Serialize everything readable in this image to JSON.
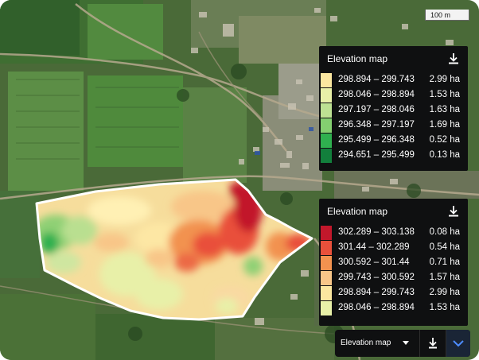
{
  "scale_label": "100 m",
  "colors": {
    "e1": "#ffe8a3",
    "e2": "#e6f0a0",
    "e3": "#b9df90",
    "e4": "#7fcf6e",
    "e5": "#34b24c",
    "e6": "#1a8a3a",
    "h1": "#c31b2c",
    "h2": "#e8513a",
    "h3": "#f29552",
    "h4": "#f9c687",
    "h5": "#ffe8a3",
    "h6": "#e6f0a0"
  },
  "panel_top": {
    "title": "Elevation map",
    "download_icon": "download-icon",
    "rows": [
      {
        "range": "298.894 – 299.743",
        "area": "2.99 ha",
        "color": "#fbe7a0"
      },
      {
        "range": "298.046 – 298.894",
        "area": "1.53 ha",
        "color": "#e8f0a8"
      },
      {
        "range": "297.197 – 298.046",
        "area": "1.63 ha",
        "color": "#bde193"
      },
      {
        "range": "296.348 – 297.197",
        "area": "1.69 ha",
        "color": "#84cf70"
      },
      {
        "range": "295.499 – 296.348",
        "area": "0.52 ha",
        "color": "#2fb04f"
      },
      {
        "range": "294.651 – 295.499",
        "area": "0.13 ha",
        "color": "#127f3c"
      }
    ]
  },
  "panel_bottom": {
    "title": "Elevation map",
    "download_icon": "download-icon",
    "rows": [
      {
        "range": "302.289 – 303.138",
        "area": "0.08 ha",
        "color": "#c2182b"
      },
      {
        "range": "301.44 – 302.289",
        "area": "0.54 ha",
        "color": "#e9503b"
      },
      {
        "range": "300.592 – 301.44",
        "area": "0.71 ha",
        "color": "#f2924f"
      },
      {
        "range": "299.743 – 300.592",
        "area": "1.57 ha",
        "color": "#f8c688"
      },
      {
        "range": "298.894 – 299.743",
        "area": "2.99 ha",
        "color": "#fbe7a0"
      },
      {
        "range": "298.046 – 298.894",
        "area": "1.53 ha",
        "color": "#e8f0a8"
      }
    ]
  },
  "toolbar": {
    "selected_layer": "Elevation map",
    "download_icon": "download-icon",
    "expand_icon": "chevron-down-icon"
  }
}
